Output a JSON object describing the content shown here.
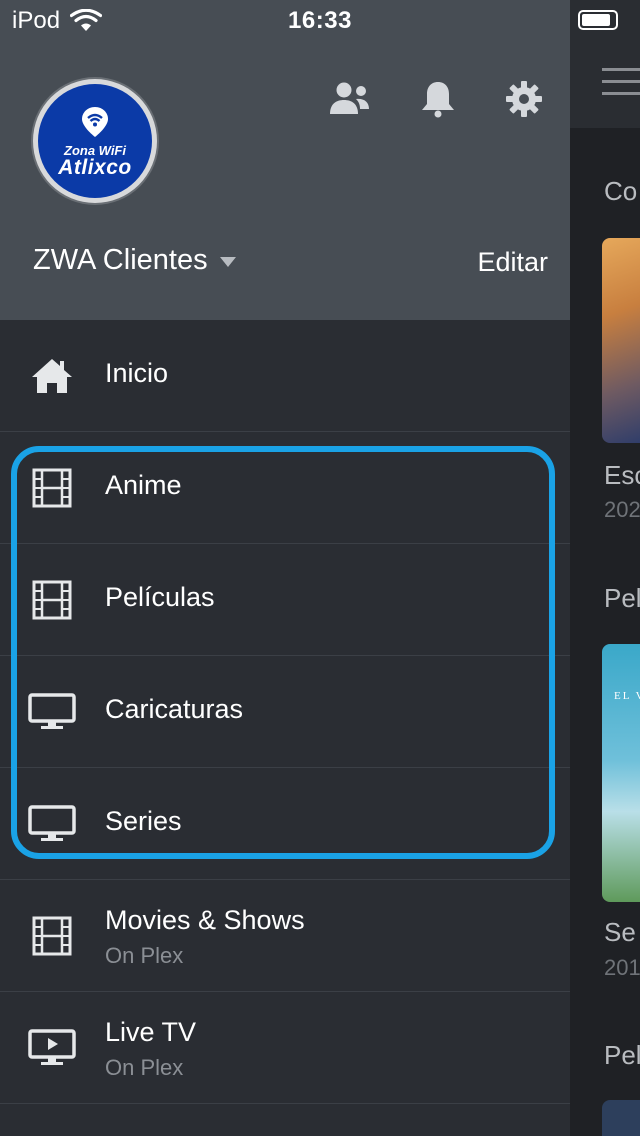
{
  "status_bar": {
    "device": "iPod",
    "time": "16:33"
  },
  "header": {
    "logo": {
      "line1": "Zona WiFi",
      "line2": "Atlixco"
    },
    "icons": [
      "users-icon",
      "bell-icon",
      "gear-icon"
    ],
    "account_name": "ZWA Clientes",
    "edit_label": "Editar"
  },
  "menu": {
    "items": [
      {
        "label": "Inicio",
        "icon": "home-icon"
      },
      {
        "label": "Anime",
        "icon": "film-icon"
      },
      {
        "label": "Películas",
        "icon": "film-icon"
      },
      {
        "label": "Caricaturas",
        "icon": "monitor-icon"
      },
      {
        "label": "Series",
        "icon": "monitor-icon"
      },
      {
        "label": "Movies & Shows",
        "sublabel": "On Plex",
        "icon": "film-icon"
      },
      {
        "label": "Live TV",
        "sublabel": "On Plex",
        "icon": "tv-play-icon"
      }
    ]
  },
  "background": {
    "section1_title": "Co",
    "item1_title": "Esc",
    "item1_year": "202",
    "section2_title": "Pel",
    "poster2_text": "EL V",
    "item2_title": "Se",
    "item2_year": "201",
    "section3_title": "Pel"
  },
  "colors": {
    "highlight": "#1aa2e6",
    "header_bg": "#474d54",
    "drawer_bg": "#2a2d33",
    "logo_blue": "#0b3aa7"
  }
}
